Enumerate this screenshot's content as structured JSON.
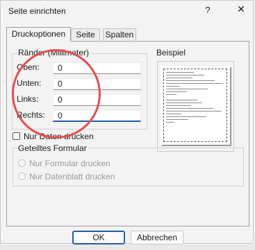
{
  "window": {
    "title": "Seite einrichten",
    "help_label": "?",
    "close_label": "✕"
  },
  "tabs": [
    {
      "label": "Druckoptionen",
      "active": true
    },
    {
      "label": "Seite",
      "active": false
    },
    {
      "label": "Spalten",
      "active": false
    }
  ],
  "margins": {
    "legend": "Ränder (Millimeter)",
    "fields": [
      {
        "label": "Oben:",
        "value": "0"
      },
      {
        "label": "Unten:",
        "value": "0"
      },
      {
        "label": "Links:",
        "value": "0"
      },
      {
        "label": "Rechts:",
        "value": "0"
      }
    ]
  },
  "preview": {
    "legend": "Beispiel"
  },
  "data_only": {
    "label": "Nur Daten drucken",
    "checked": false
  },
  "split_form": {
    "legend": "Geteiltes Formular",
    "options": [
      {
        "label": "Nur Formular drucken"
      },
      {
        "label": "Nur Datenblatt drucken"
      }
    ]
  },
  "buttons": {
    "ok": "OK",
    "cancel": "Abbrechen"
  },
  "colors": {
    "annotation": "#e74c4c",
    "focus": "#1f5fa8"
  }
}
